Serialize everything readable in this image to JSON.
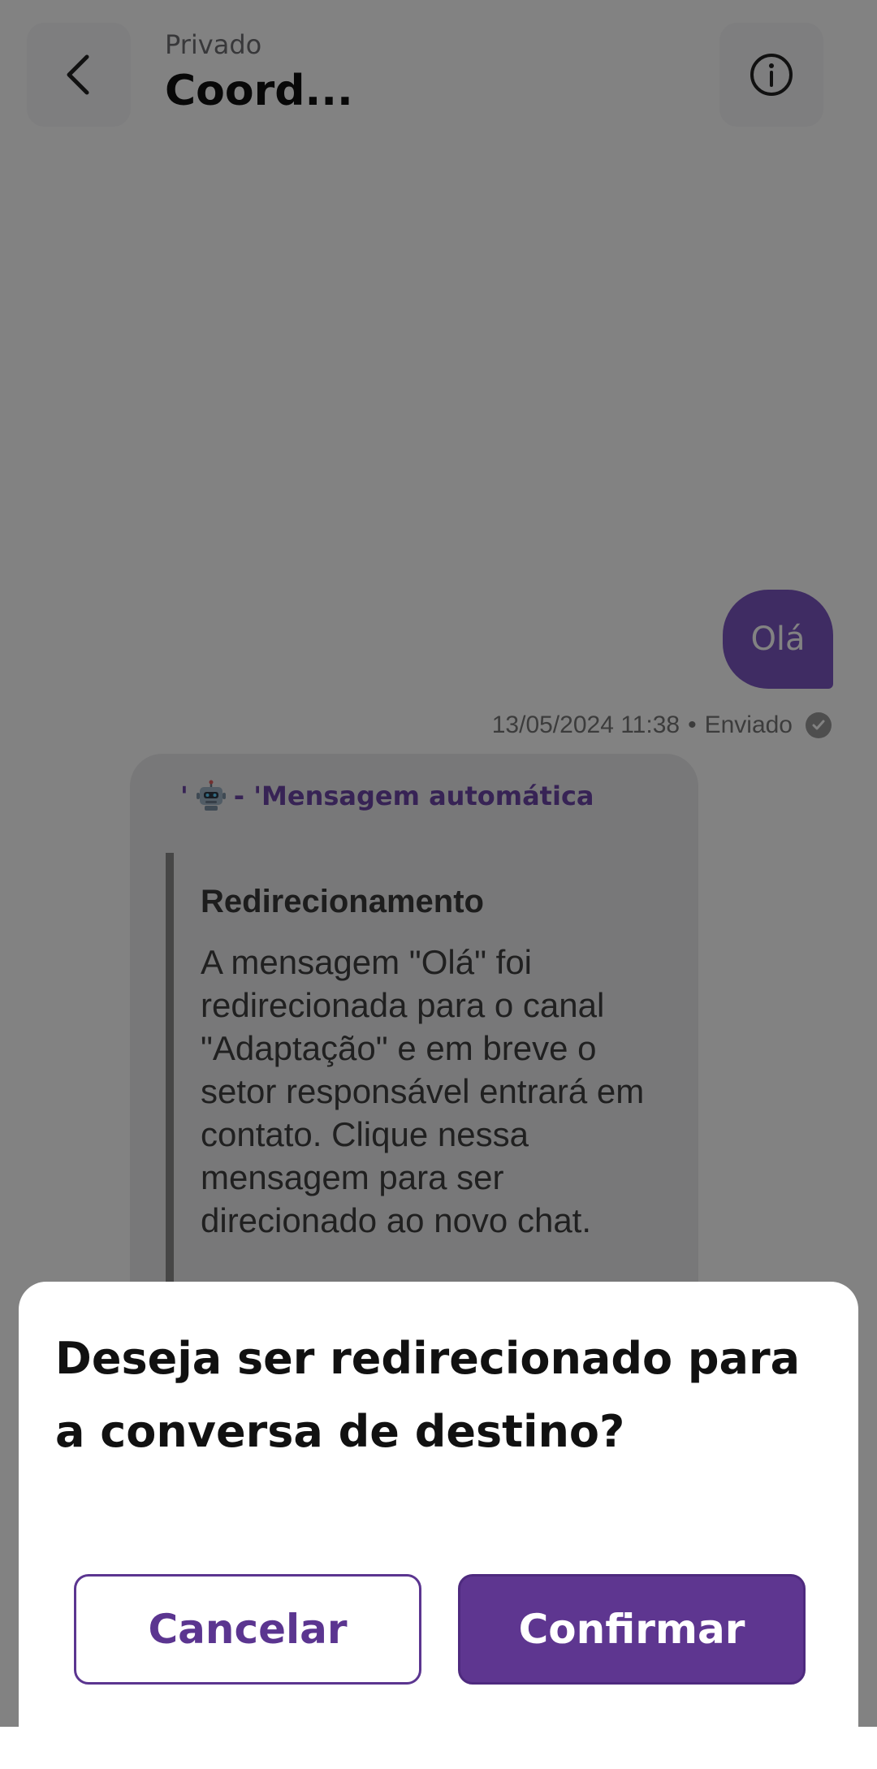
{
  "header": {
    "subtitle": "Privado",
    "title": "Coord..."
  },
  "chat": {
    "sent_message": "Olá",
    "timestamp": "13/05/2024 11:38",
    "separator": "•",
    "status": "Enviado",
    "auto_message": {
      "sender": "- 'Mensagem automática",
      "prefix": "'",
      "title": "Redirecionamento",
      "body": "A mensagem \"Olá\" foi redirecionada para o canal \"Adaptação\" e em breve o setor responsável entrará em contato. Clique nessa mensagem para ser direcionado ao novo chat."
    }
  },
  "dialog": {
    "question": "Deseja ser redirecionado para a conversa de destino?",
    "cancel_label": "Cancelar",
    "confirm_label": "Confirmar"
  },
  "colors": {
    "accent": "#5e3690",
    "bubble": "#7d57c2",
    "scrim": "rgba(0,0,0,0.49)"
  },
  "icons": {
    "back": "chevron-left-icon",
    "info": "info-icon",
    "check": "check-circle-icon",
    "robot": "robot-icon"
  }
}
